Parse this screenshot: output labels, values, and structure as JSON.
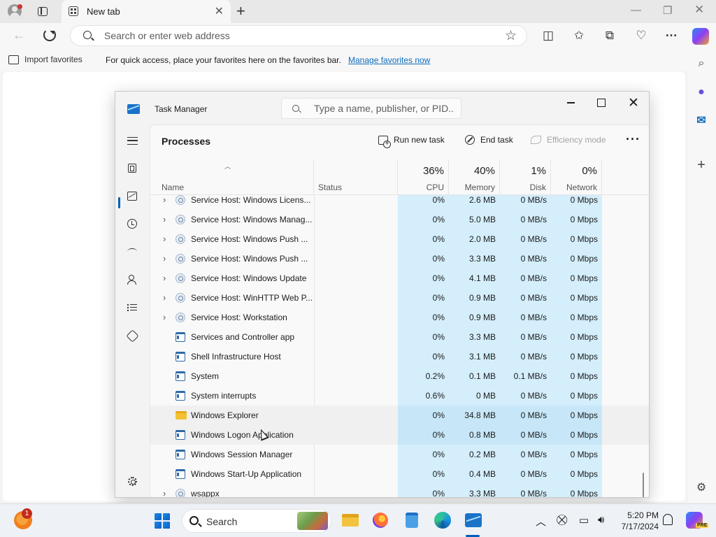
{
  "browser": {
    "tab_title": "New tab",
    "address_placeholder": "Search or enter web address",
    "favbar": {
      "import_label": "Import favorites",
      "message": "For quick access, place your favorites here on the favorites bar.",
      "manage_link": "Manage favorites now"
    }
  },
  "task_manager": {
    "title": "Task Manager",
    "search_placeholder": "Type a name, publisher, or PID...",
    "page_heading": "Processes",
    "commands": {
      "run_new_task": "Run new task",
      "end_task": "End task",
      "efficiency_mode": "Efficiency mode"
    },
    "columns": {
      "name": "Name",
      "status": "Status",
      "cpu_pct": "36%",
      "cpu": "CPU",
      "memory_pct": "40%",
      "memory": "Memory",
      "disk_pct": "1%",
      "disk": "Disk",
      "network_pct": "0%",
      "network": "Network"
    },
    "processes": [
      {
        "name": "Service Host: Windows Licens...",
        "icon": "service-icon",
        "expandable": true,
        "cpu": "0%",
        "memory": "2.6 MB",
        "disk": "0 MB/s",
        "network": "0 Mbps"
      },
      {
        "name": "Service Host: Windows Manag...",
        "icon": "service-icon",
        "expandable": true,
        "cpu": "0%",
        "memory": "5.0 MB",
        "disk": "0 MB/s",
        "network": "0 Mbps"
      },
      {
        "name": "Service Host: Windows Push ...",
        "icon": "service-icon",
        "expandable": true,
        "cpu": "0%",
        "memory": "2.0 MB",
        "disk": "0 MB/s",
        "network": "0 Mbps"
      },
      {
        "name": "Service Host: Windows Push ...",
        "icon": "service-icon",
        "expandable": true,
        "cpu": "0%",
        "memory": "3.3 MB",
        "disk": "0 MB/s",
        "network": "0 Mbps"
      },
      {
        "name": "Service Host: Windows Update",
        "icon": "service-icon",
        "expandable": true,
        "cpu": "0%",
        "memory": "4.1 MB",
        "disk": "0 MB/s",
        "network": "0 Mbps"
      },
      {
        "name": "Service Host: WinHTTP Web P...",
        "icon": "service-icon",
        "expandable": true,
        "cpu": "0%",
        "memory": "0.9 MB",
        "disk": "0 MB/s",
        "network": "0 Mbps"
      },
      {
        "name": "Service Host: Workstation",
        "icon": "service-icon",
        "expandable": true,
        "cpu": "0%",
        "memory": "0.9 MB",
        "disk": "0 MB/s",
        "network": "0 Mbps"
      },
      {
        "name": "Services and Controller app",
        "icon": "window-icon",
        "expandable": false,
        "cpu": "0%",
        "memory": "3.3 MB",
        "disk": "0 MB/s",
        "network": "0 Mbps"
      },
      {
        "name": "Shell Infrastructure Host",
        "icon": "window-icon",
        "expandable": false,
        "cpu": "0%",
        "memory": "3.1 MB",
        "disk": "0 MB/s",
        "network": "0 Mbps"
      },
      {
        "name": "System",
        "icon": "window-icon",
        "expandable": false,
        "cpu": "0.2%",
        "memory": "0.1 MB",
        "disk": "0.1 MB/s",
        "network": "0 Mbps"
      },
      {
        "name": "System interrupts",
        "icon": "window-icon",
        "expandable": false,
        "cpu": "0.6%",
        "memory": "0 MB",
        "disk": "0 MB/s",
        "network": "0 Mbps"
      },
      {
        "name": "Windows Explorer",
        "icon": "folder-icon",
        "expandable": false,
        "cpu": "0%",
        "memory": "34.8 MB",
        "disk": "0 MB/s",
        "network": "0 Mbps"
      },
      {
        "name": "Windows Logon Application",
        "icon": "window-icon",
        "expandable": false,
        "cpu": "0%",
        "memory": "0.8 MB",
        "disk": "0 MB/s",
        "network": "0 Mbps"
      },
      {
        "name": "Windows Session Manager",
        "icon": "window-icon",
        "expandable": false,
        "cpu": "0%",
        "memory": "0.2 MB",
        "disk": "0 MB/s",
        "network": "0 Mbps"
      },
      {
        "name": "Windows Start-Up Application",
        "icon": "window-icon",
        "expandable": false,
        "cpu": "0%",
        "memory": "0.4 MB",
        "disk": "0 MB/s",
        "network": "0 Mbps"
      },
      {
        "name": "wsappx",
        "icon": "service-icon",
        "expandable": true,
        "cpu": "0%",
        "memory": "3.3 MB",
        "disk": "0 MB/s",
        "network": "0 Mbps"
      }
    ]
  },
  "taskbar": {
    "search_label": "Search",
    "notification_badge": "1",
    "time": "5:20 PM",
    "date": "7/17/2024",
    "copilot_badge": "PRE"
  }
}
